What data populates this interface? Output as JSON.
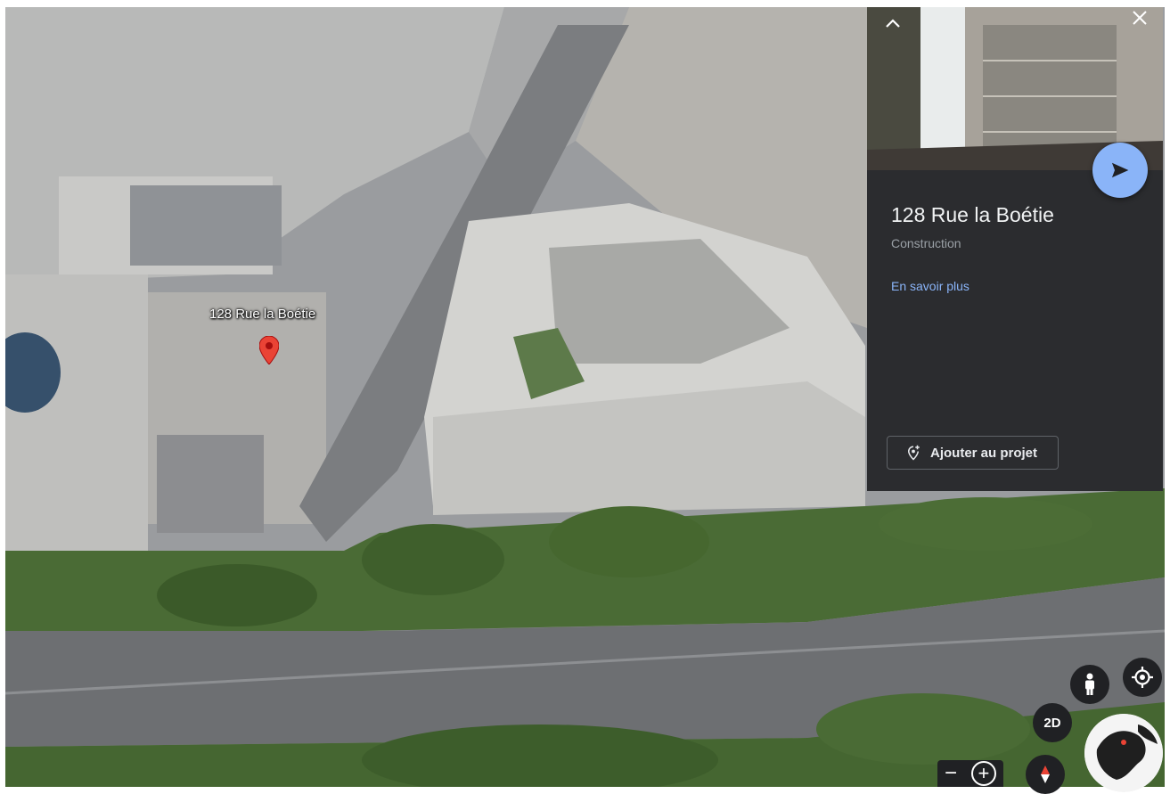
{
  "map": {
    "pin_label": "128 Rue la Boétie"
  },
  "panel": {
    "title": "128 Rue la Boétie",
    "subtitle": "Construction",
    "more_link": "En savoir plus",
    "add_button": "Ajouter au projet",
    "collapse_icon": "chevron-up-icon",
    "close_icon": "close-icon",
    "fly_icon": "paper-plane-icon"
  },
  "controls": {
    "view_mode": "2D",
    "zoom_out": "−",
    "zoom_in": "+",
    "pegman_icon": "street-view-person-icon",
    "locate_icon": "my-location-icon",
    "compass_icon": "compass-icon",
    "globe_icon": "globe-icon"
  },
  "colors": {
    "panel_bg": "#2b2c2f",
    "accent": "#8ab4f8",
    "pin": "#ea4335",
    "control_bg": "#202124"
  }
}
